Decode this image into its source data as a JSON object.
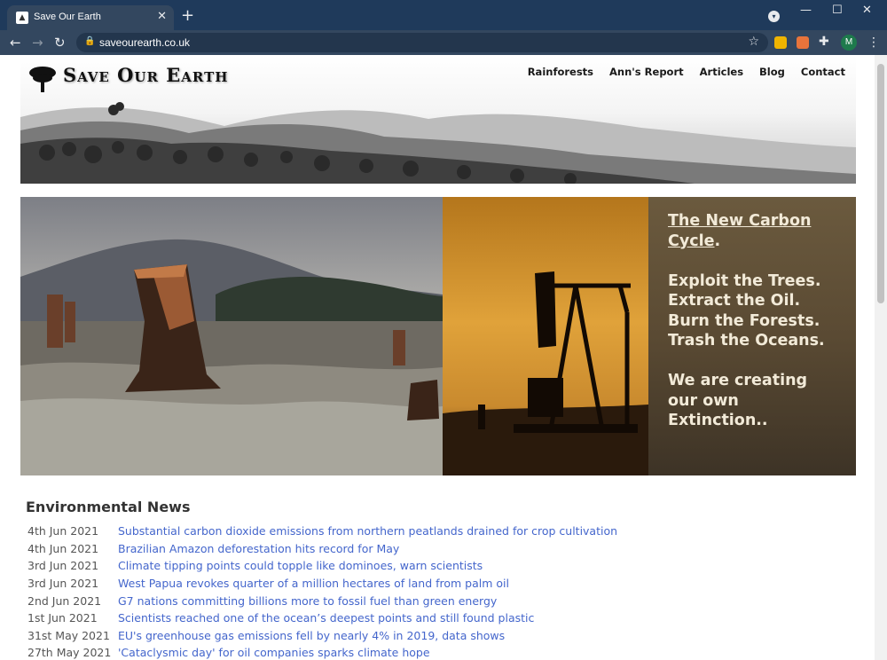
{
  "browser": {
    "tab_title": "Save Our Earth",
    "url": "saveourearth.co.uk",
    "profile_initial": "M"
  },
  "site": {
    "logo_text": "Save Our Earth",
    "nav": [
      "Rainforests",
      "Ann's Report",
      "Articles",
      "Blog",
      "Contact"
    ]
  },
  "hero": {
    "link_text": "The New Carbon Cycle",
    "link_suffix": ".",
    "lines": [
      "Exploit the Trees.",
      "Extract the Oil.",
      "Burn the Forests.",
      "Trash the Oceans."
    ],
    "closing": [
      "We are creating",
      "our own",
      "Extinction.."
    ]
  },
  "news": {
    "title": "Environmental News",
    "items": [
      {
        "date": "4th Jun 2021",
        "headline": "Substantial carbon dioxide emissions from northern peatlands drained for crop cultivation"
      },
      {
        "date": "4th Jun 2021",
        "headline": "Brazilian Amazon deforestation hits record for May"
      },
      {
        "date": "3rd Jun 2021",
        "headline": "Climate tipping points could topple like dominoes, warn scientists"
      },
      {
        "date": "3rd Jun 2021",
        "headline": "West Papua revokes quarter of a million hectares of land from palm oil"
      },
      {
        "date": "2nd Jun 2021",
        "headline": "G7 nations committing billions more to fossil fuel than green energy"
      },
      {
        "date": "1st Jun 2021",
        "headline": "Scientists reached one of the ocean’s deepest points and still found plastic"
      },
      {
        "date": "31st May 2021",
        "headline": "EU's greenhouse gas emissions fell by nearly 4% in 2019, data shows"
      },
      {
        "date": "27th May 2021",
        "headline": "'Cataclysmic day' for oil companies sparks climate hope"
      }
    ]
  },
  "colors": {
    "chrome_dark": "#1f3a5b",
    "chrome_mid": "#33475f",
    "link_blue": "#4466cc",
    "hero_text": "#f2ead8"
  }
}
